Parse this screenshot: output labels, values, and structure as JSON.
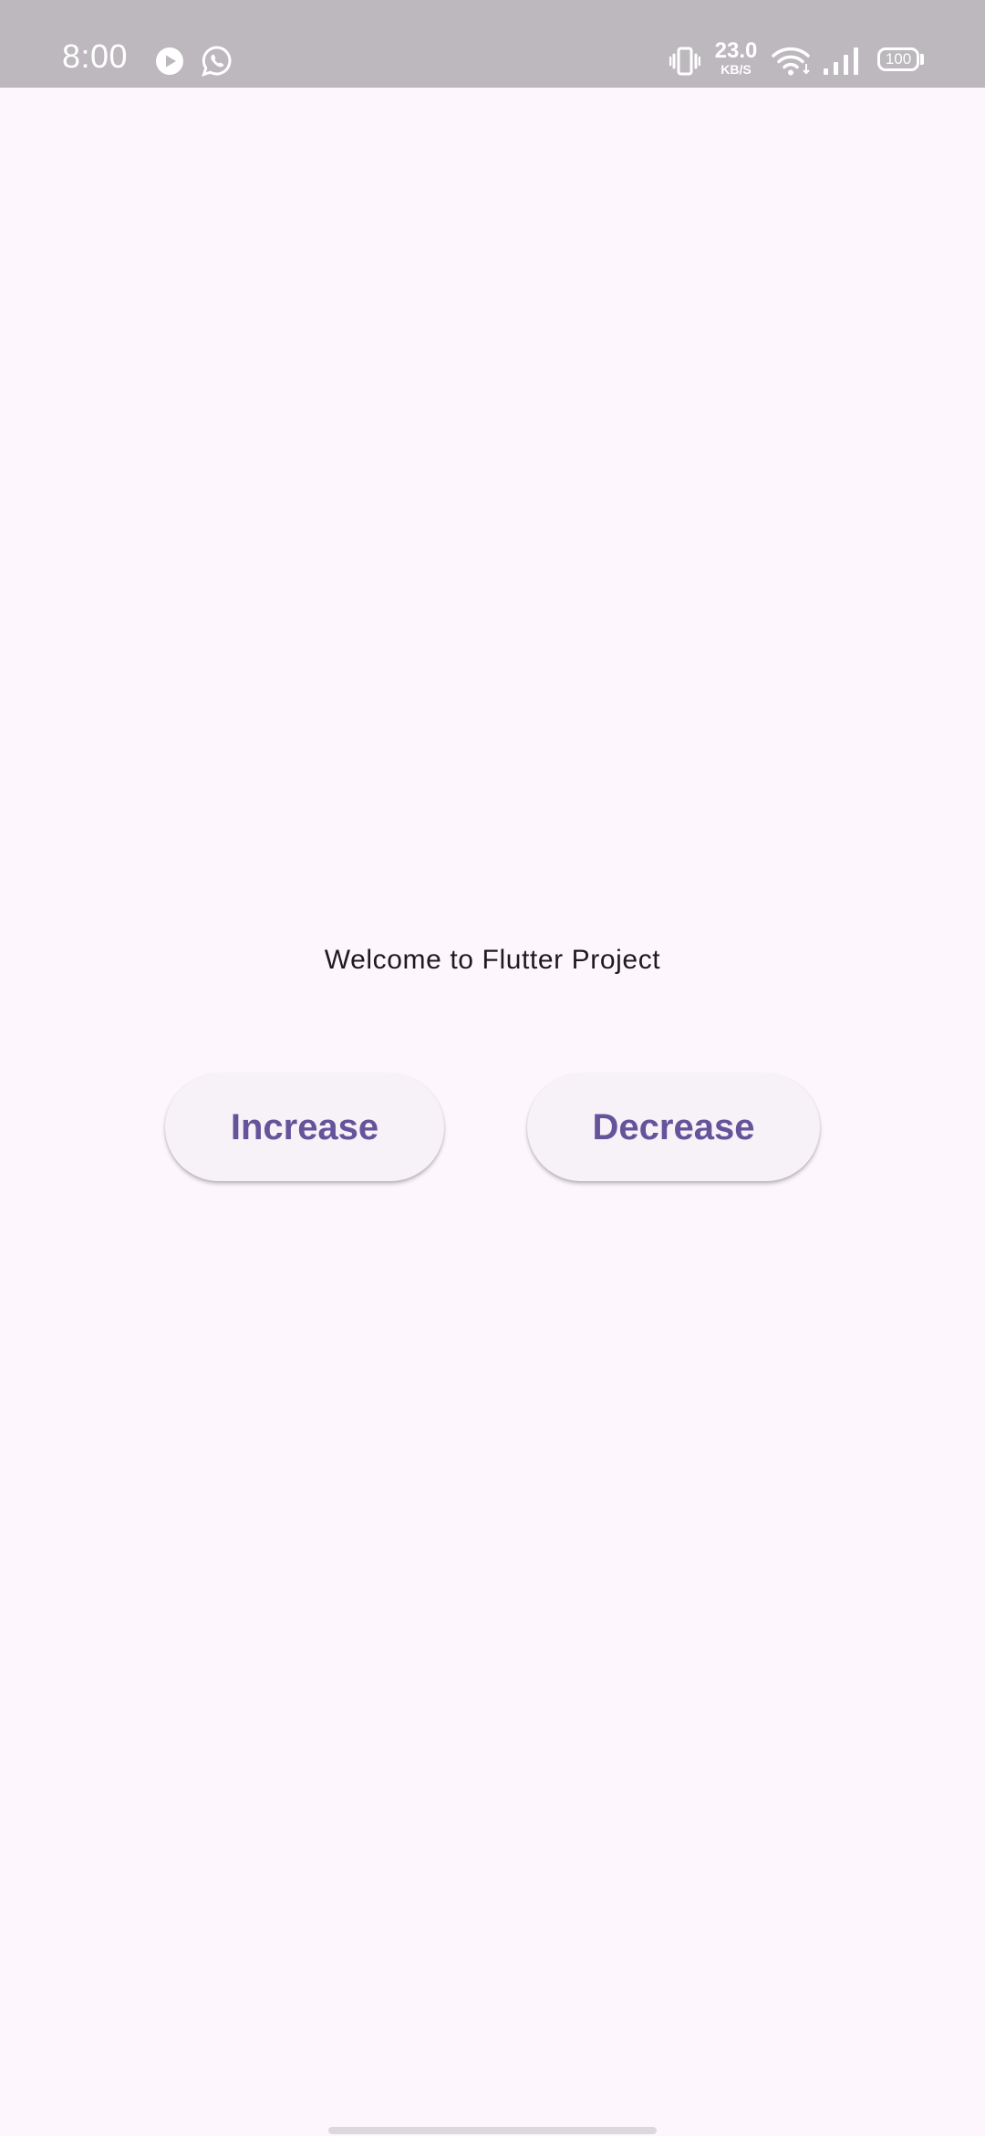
{
  "status_bar": {
    "time": "8:00",
    "net_speed_value": "23.0",
    "net_speed_unit": "KB/S",
    "battery_level": "100",
    "icons": [
      "play-icon",
      "whatsapp-icon",
      "vibrate-icon",
      "wifi-icon",
      "signal-icon",
      "battery-icon"
    ]
  },
  "main": {
    "welcome_text": "Welcome to Flutter Project",
    "increase_label": "Increase",
    "decrease_label": "Decrease"
  },
  "colors": {
    "background": "#FDF7FD",
    "status_bar": "#BCB8BD",
    "button_background": "#F6F2F8",
    "button_text": "#65549A",
    "body_text": "#1D1B20"
  }
}
